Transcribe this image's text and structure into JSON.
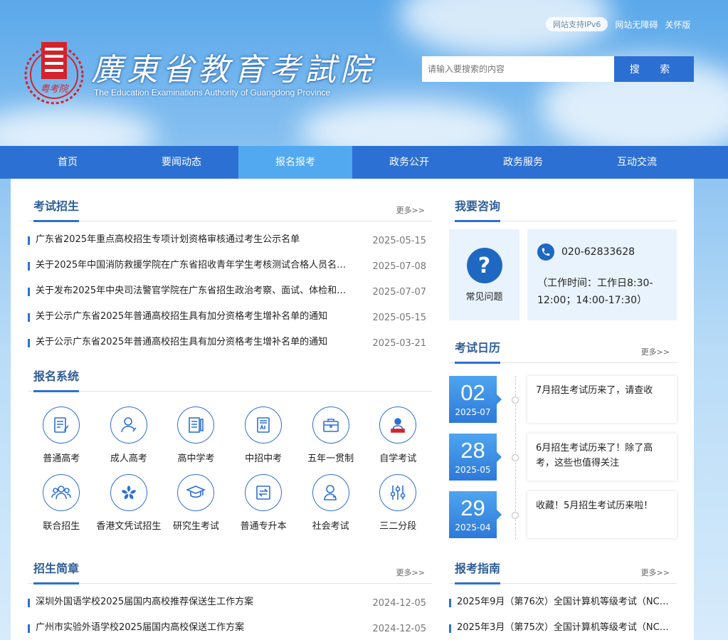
{
  "header": {
    "logo_title": "廣東省教育考試院",
    "logo_en": "The Education Examinations Authority of Guangdong Province",
    "logo_emblem_text": "粤考院",
    "top_links": [
      "网站支持IPv6",
      "网站无障碍",
      "关怀版"
    ],
    "search_placeholder": "请输入要搜索的内容",
    "search_button": "搜 索"
  },
  "nav": {
    "items": [
      "首页",
      "要闻动态",
      "报名报考",
      "政务公开",
      "政务服务",
      "互动交流"
    ],
    "active": "报名报考"
  },
  "more_label": "更多>>",
  "exam_recruit": {
    "title": "考试招生",
    "items": [
      {
        "title": "广东省2025年重点高校招生专项计划资格审核通过考生公示名单",
        "date": "2025-05-15"
      },
      {
        "title": "关于2025年中国消防救援学院在广东省招收青年学生考核测试合格人员名单...",
        "date": "2025-07-08"
      },
      {
        "title": "关于发布2025年中央司法警官学院在广东省招生政治考察、面试、体检和体...",
        "date": "2025-07-07"
      },
      {
        "title": "关于公示广东省2025年普通高校招生具有加分资格考生增补名单的通知",
        "date": "2025-05-15"
      },
      {
        "title": "关于公示广东省2025年普通高校招生具有加分资格考生增补名单的通知",
        "date": "2025-03-21"
      }
    ]
  },
  "registration": {
    "title": "报名系统",
    "items": [
      {
        "label": "普通高考",
        "icon": "exam-paper-icon"
      },
      {
        "label": "成人高考",
        "icon": "adult-person-icon"
      },
      {
        "label": "高中学考",
        "icon": "book-icon"
      },
      {
        "label": "中招中考",
        "icon": "score-sheet-icon"
      },
      {
        "label": "五年一贯制",
        "icon": "briefcase-icon"
      },
      {
        "label": "自学考试",
        "icon": "self-study-icon"
      },
      {
        "label": "联合招生",
        "icon": "group-icon"
      },
      {
        "label": "香港文凭试招生",
        "icon": "bauhinia-icon"
      },
      {
        "label": "研究生考试",
        "icon": "graduation-cap-icon"
      },
      {
        "label": "普通专升本",
        "icon": "upgrade-icon"
      },
      {
        "label": "社会考试",
        "icon": "social-person-icon"
      },
      {
        "label": "三二分段",
        "icon": "sliders-icon"
      }
    ]
  },
  "brochure": {
    "title": "招生简章",
    "items": [
      {
        "title": "深圳外国语学校2025届国内高校推荐保送生工作方案",
        "date": "2024-12-05"
      },
      {
        "title": "广州市实验外语学校2025届国内高校保送工作方案",
        "date": "2024-12-05"
      }
    ]
  },
  "consult": {
    "title": "我要咨询",
    "faq_label": "常见问题",
    "phone": "020-62833628",
    "hours": "（工作时间：工作日8:30-12:00；14:00-17:30）"
  },
  "calendar": {
    "title": "考试日历",
    "items": [
      {
        "day": "02",
        "ym": "2025-07",
        "text": "7月招生考试历来了，请查收"
      },
      {
        "day": "28",
        "ym": "2025-05",
        "text": "6月招生考试历来了！除了高考，这些也值得关注"
      },
      {
        "day": "29",
        "ym": "2025-04",
        "text": "收藏！5月招生考试历来啦！"
      }
    ]
  },
  "guide": {
    "title": "报考指南",
    "items": [
      {
        "title": "2025年9月（第76次）全国计算机等级考试（NCRE..."
      },
      {
        "title": "2025年3月（第75次）全国计算机等级考试（NCRE..."
      }
    ]
  },
  "colors": {
    "primary": "#2d70d4",
    "nav_active": "#52a9f0",
    "title": "#2d5d95",
    "emblem_red": "#d4232b"
  }
}
